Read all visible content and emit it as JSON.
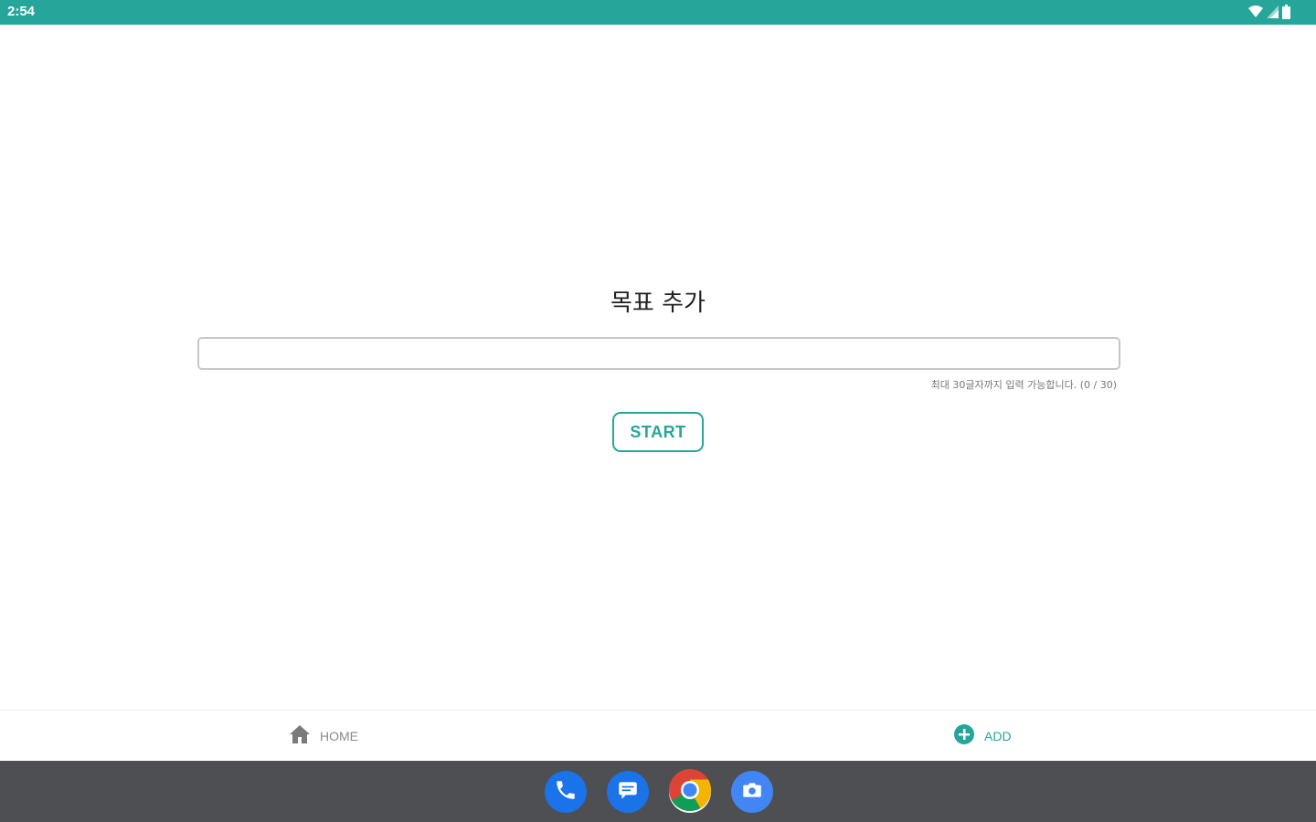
{
  "status_bar": {
    "time": "2:54",
    "background_color": "#26a69a",
    "icons": [
      "wifi-icon",
      "signal-icon",
      "battery-icon"
    ]
  },
  "main": {
    "title": "목표 추가",
    "input": {
      "value": "",
      "placeholder": ""
    },
    "helper_text": "최대 30글자까지 입력 가능합니다. (0 / 30)",
    "start_button_label": "START",
    "accent_color": "#26a69a"
  },
  "bottom_nav": {
    "items": [
      {
        "label": "HOME",
        "icon": "home-icon",
        "color": "#8a8a8a"
      },
      {
        "label": "ADD",
        "icon": "add-circle-icon",
        "color": "#26a69a"
      }
    ]
  },
  "dock": {
    "apps": [
      {
        "name": "phone",
        "icon": "phone-icon"
      },
      {
        "name": "messages",
        "icon": "messages-icon"
      },
      {
        "name": "chrome",
        "icon": "chrome-icon"
      },
      {
        "name": "camera",
        "icon": "camera-icon"
      }
    ]
  }
}
